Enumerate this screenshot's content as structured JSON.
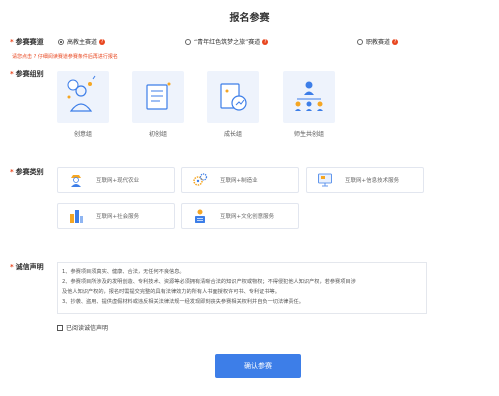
{
  "page": {
    "title": "报名参赛"
  },
  "track": {
    "label": "参赛赛道",
    "options": [
      {
        "text": "高教主赛道",
        "selected": true
      },
      {
        "text": "“青年红色筑梦之旅”赛道",
        "selected": false
      },
      {
        "text": "职教赛道",
        "selected": false
      }
    ],
    "info_glyph": "?",
    "hint": "请您点击 ? 仔细阅读赛道参赛条件后再进行报名"
  },
  "group": {
    "label": "参赛组别",
    "items": [
      {
        "name": "创意组",
        "icon": "idea-person-icon"
      },
      {
        "name": "初创组",
        "icon": "document-icon"
      },
      {
        "name": "成长组",
        "icon": "growth-chart-icon"
      },
      {
        "name": "师生共创组",
        "icon": "team-icon"
      }
    ]
  },
  "category": {
    "label": "参赛类别",
    "items": [
      {
        "name": "互联网+现代农业",
        "icon": "farmer-icon"
      },
      {
        "name": "互联网+制造业",
        "icon": "gears-icon"
      },
      {
        "name": "互联网+信息技术服务",
        "icon": "monitor-icon"
      },
      {
        "name": "互联网+社会服务",
        "icon": "city-icon"
      },
      {
        "name": "互联网+文化创意服务",
        "icon": "reader-icon"
      }
    ]
  },
  "declaration": {
    "label": "诚信声明",
    "lines": [
      "1、参赛项目须真实、健康、合法，无任何不良信息。",
      "2、参赛项目所涉及的发明创造、专利技术、资源等必须拥有清晰合法的知识产权或物权；不得侵犯他人知识产权，若参赛项目涉",
      "及他人知识产权的，报名时需提交完整的具有法律效力的所有人书面授权许可书、专利证书等。",
      "3、抄袭、盗用、提供虚假材料或违反相关法律法规一经发现即刻丧失参赛相关权利并自负一切法律责任。"
    ],
    "checkbox_label": "已阅读诚信声明"
  },
  "submit": {
    "label": "确认参赛"
  },
  "colors": {
    "primary": "#3d7ee8",
    "required": "#e8451e",
    "tile_bg": "#eef3fc"
  }
}
